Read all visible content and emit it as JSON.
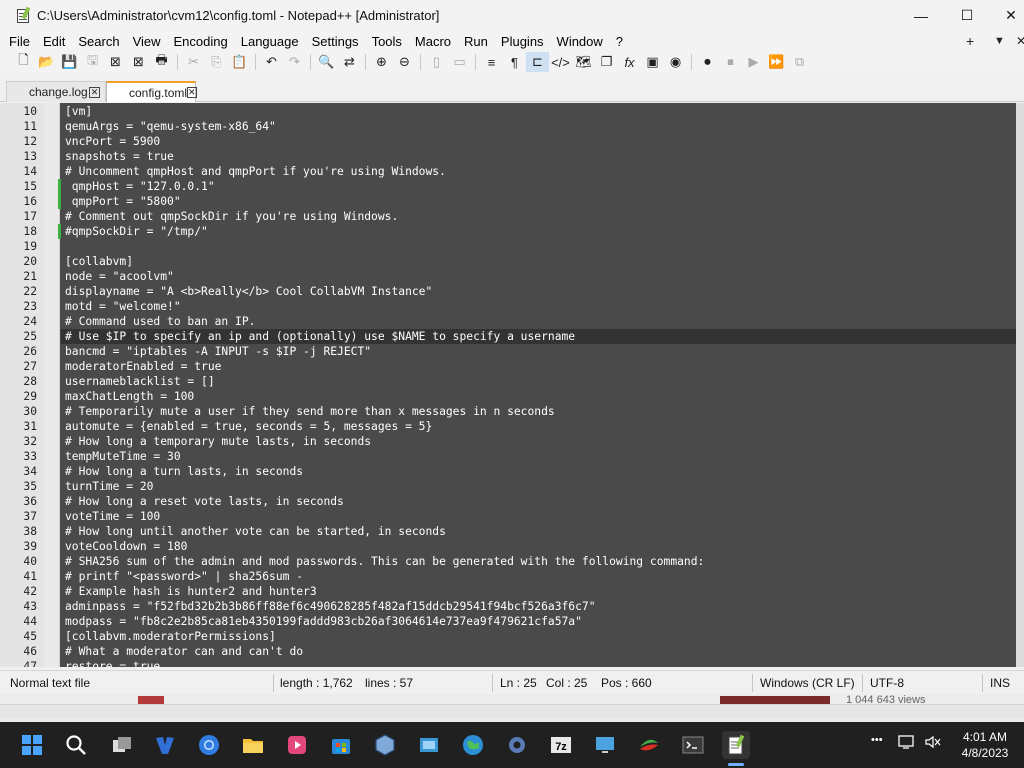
{
  "window": {
    "title": "C:\\Users\\Administrator\\cvm12\\config.toml - Notepad++ [Administrator]",
    "minimize": "—",
    "maximize": "☐",
    "close": "✕"
  },
  "menu": {
    "items": [
      "File",
      "Edit",
      "Search",
      "View",
      "Encoding",
      "Language",
      "Settings",
      "Tools",
      "Macro",
      "Run",
      "Plugins",
      "Window",
      "?"
    ],
    "plus": "+",
    "dropdown": "▼",
    "close": "✕"
  },
  "toolbar": {
    "icons": [
      "new-file-icon",
      "open-file-icon",
      "save-icon",
      "save-all-icon",
      "close-icon",
      "close-all-icon",
      "print-icon",
      "cut-icon",
      "copy-icon",
      "paste-icon",
      "undo-icon",
      "redo-icon",
      "find-icon",
      "replace-icon",
      "zoom-in-icon",
      "zoom-out-icon",
      "sync-v-icon",
      "sync-h-icon",
      "word-wrap-icon",
      "show-all-chars-icon",
      "indent-guide-icon",
      "xml-icon",
      "doc-map-icon",
      "doc-list-icon",
      "function-list-icon",
      "monitor-icon",
      "folder-as-workspace-icon",
      "record-macro-icon",
      "stop-macro-icon",
      "play-macro-icon",
      "run-macro-multiple-icon",
      "save-macro-icon"
    ]
  },
  "tabs": [
    {
      "label": "change.log",
      "close": "✕"
    },
    {
      "label": "config.toml",
      "close": "✕"
    }
  ],
  "editor": {
    "lines": [
      {
        "num": "10",
        "text": "[vm]"
      },
      {
        "num": "11",
        "text": "qemuArgs = \"qemu-system-x86_64\""
      },
      {
        "num": "12",
        "text": "vncPort = 5900"
      },
      {
        "num": "13",
        "text": "snapshots = true"
      },
      {
        "num": "14",
        "text": "# Uncomment qmpHost and qmpPort if you're using Windows."
      },
      {
        "num": "15",
        "text": " qmpHost = \"127.0.0.1\""
      },
      {
        "num": "16",
        "text": " qmpPort = \"5800\""
      },
      {
        "num": "17",
        "text": "# Comment out qmpSockDir if you're using Windows."
      },
      {
        "num": "18",
        "text": "#qmpSockDir = \"/tmp/\""
      },
      {
        "num": "19",
        "text": ""
      },
      {
        "num": "20",
        "text": "[collabvm]"
      },
      {
        "num": "21",
        "text": "node = \"acoolvm\""
      },
      {
        "num": "22",
        "text": "displayname = \"A <b>Really</b> Cool CollabVM Instance\""
      },
      {
        "num": "23",
        "text": "motd = \"welcome!\""
      },
      {
        "num": "24",
        "text": "# Command used to ban an IP."
      },
      {
        "num": "25",
        "text": "# Use $IP to specify an ip and (optionally) use $NAME to specify a username"
      },
      {
        "num": "26",
        "text": "bancmd = \"iptables -A INPUT -s $IP -j REJECT\""
      },
      {
        "num": "27",
        "text": "moderatorEnabled = true"
      },
      {
        "num": "28",
        "text": "usernameblacklist = []"
      },
      {
        "num": "29",
        "text": "maxChatLength = 100"
      },
      {
        "num": "30",
        "text": "# Temporarily mute a user if they send more than x messages in n seconds"
      },
      {
        "num": "31",
        "text": "automute = {enabled = true, seconds = 5, messages = 5}"
      },
      {
        "num": "32",
        "text": "# How long a temporary mute lasts, in seconds"
      },
      {
        "num": "33",
        "text": "tempMuteTime = 30"
      },
      {
        "num": "34",
        "text": "# How long a turn lasts, in seconds"
      },
      {
        "num": "35",
        "text": "turnTime = 20"
      },
      {
        "num": "36",
        "text": "# How long a reset vote lasts, in seconds"
      },
      {
        "num": "37",
        "text": "voteTime = 100"
      },
      {
        "num": "38",
        "text": "# How long until another vote can be started, in seconds"
      },
      {
        "num": "39",
        "text": "voteCooldown = 180"
      },
      {
        "num": "40",
        "text": "# SHA256 sum of the admin and mod passwords. This can be generated with the following command:"
      },
      {
        "num": "41",
        "text": "# printf \"<password>\" | sha256sum -"
      },
      {
        "num": "42",
        "text": "# Example hash is hunter2 and hunter3"
      },
      {
        "num": "43",
        "text": "adminpass = \"f52fbd32b2b3b86ff88ef6c490628285f482af15ddcb29541f94bcf526a3f6c7\""
      },
      {
        "num": "44",
        "text": "modpass = \"fb8c2e2b85ca81eb4350199faddd983cb26af3064614e737ea9f479621cfa57a\""
      },
      {
        "num": "45",
        "text": "[collabvm.moderatorPermissions]"
      },
      {
        "num": "46",
        "text": "# What a moderator can and can't do"
      },
      {
        "num": "47",
        "text": "restore = true"
      }
    ]
  },
  "status": {
    "mode": "Normal text file",
    "length": "length : 1,762",
    "lines": "lines : 57",
    "ln": "Ln : 25",
    "col": "Col : 25",
    "pos": "Pos : 660",
    "eol": "Windows (CR LF)",
    "encoding": "UTF-8",
    "ins": "INS"
  },
  "background_window": {
    "views": "1 044 643 views"
  },
  "taskbar": {
    "time": "4:01 AM",
    "date": "4/8/2023",
    "overflow": "•••"
  }
}
